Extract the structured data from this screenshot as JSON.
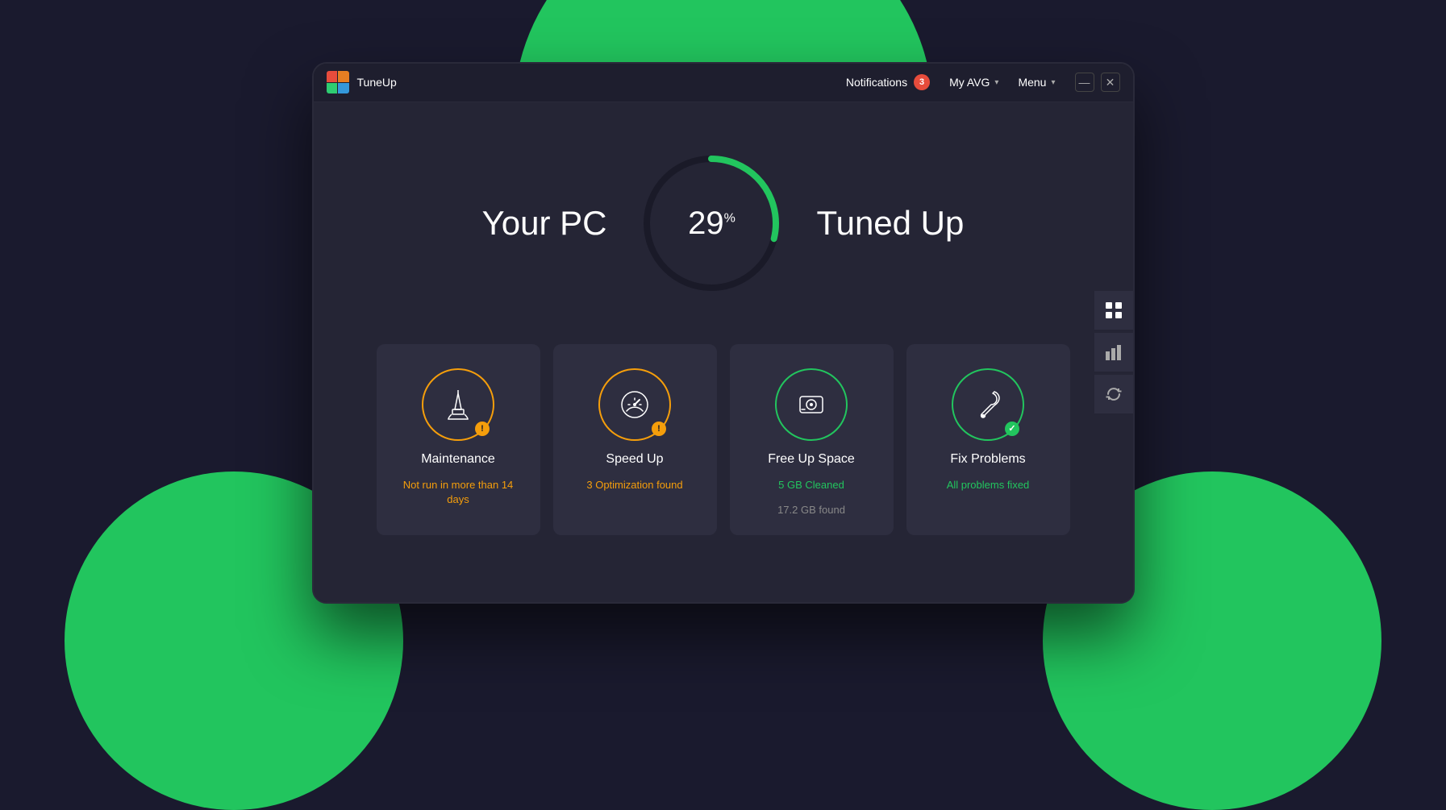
{
  "app": {
    "logo_label": "AVG",
    "app_name": "TuneUp"
  },
  "header": {
    "notifications_label": "Notifications",
    "notifications_count": "3",
    "my_avg_label": "My AVG",
    "menu_label": "Menu",
    "minimize_label": "—",
    "close_label": "✕"
  },
  "gauge": {
    "left_label": "Your PC",
    "right_label": "Tuned Up",
    "percent": "29",
    "percent_unit": "%"
  },
  "cards": [
    {
      "id": "maintenance",
      "title": "Maintenance",
      "status": "Not run in more than 14 days",
      "status_type": "warning",
      "icon_type": "broom",
      "ring_color": "orange",
      "badge": "warning"
    },
    {
      "id": "speed-up",
      "title": "Speed Up",
      "status": "3 Optimization found",
      "status_type": "warning",
      "icon_type": "speedometer",
      "ring_color": "orange",
      "badge": "warning"
    },
    {
      "id": "free-up-space",
      "title": "Free Up Space",
      "status": "5 GB Cleaned",
      "status_sub": "17.2 GB found",
      "status_type": "green",
      "icon_type": "hdd",
      "ring_color": "green",
      "badge": "none"
    },
    {
      "id": "fix-problems",
      "title": "Fix Problems",
      "status": "All problems fixed",
      "status_type": "green",
      "icon_type": "wrench",
      "ring_color": "green",
      "badge": "check"
    }
  ],
  "side_icons": [
    {
      "name": "grid-icon",
      "symbol": "⊞"
    },
    {
      "name": "bar-chart-icon",
      "symbol": "▐"
    },
    {
      "name": "refresh-icon",
      "symbol": "↺"
    }
  ]
}
